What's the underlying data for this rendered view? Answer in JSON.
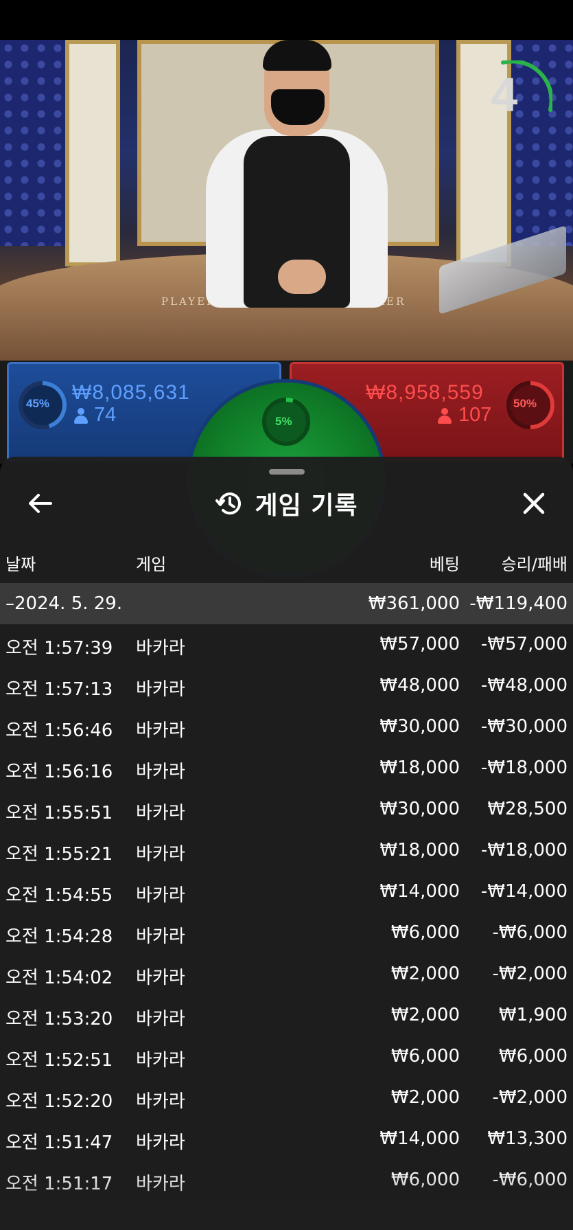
{
  "video": {
    "countdown": "4",
    "table_labels": {
      "player": "PLAYER",
      "banker": "BANKER"
    }
  },
  "bets": {
    "player": {
      "percent": "45%",
      "percent_value": 45,
      "amount": "₩8,085,631",
      "count": "74",
      "color": "#3d7fd6"
    },
    "tie": {
      "percent": "5%",
      "percent_value": 5,
      "color": "#23c14a"
    },
    "banker": {
      "percent": "50%",
      "percent_value": 50,
      "amount": "₩8,958,559",
      "count": "107",
      "color": "#e03a3a"
    }
  },
  "history": {
    "title": "게임 기록",
    "columns": {
      "date": "날짜",
      "game": "게임",
      "bet": "베팅",
      "result": "승리/패배"
    },
    "day": {
      "date": "–2024. 5. 29.",
      "bet_total": "₩361,000",
      "result_total": "-₩119,400"
    },
    "rows": [
      {
        "time": "오전 1:57:39",
        "game": "바카라",
        "bet": "₩57,000",
        "result": "-₩57,000"
      },
      {
        "time": "오전 1:57:13",
        "game": "바카라",
        "bet": "₩48,000",
        "result": "-₩48,000"
      },
      {
        "time": "오전 1:56:46",
        "game": "바카라",
        "bet": "₩30,000",
        "result": "-₩30,000"
      },
      {
        "time": "오전 1:56:16",
        "game": "바카라",
        "bet": "₩18,000",
        "result": "-₩18,000"
      },
      {
        "time": "오전 1:55:51",
        "game": "바카라",
        "bet": "₩30,000",
        "result": "₩28,500"
      },
      {
        "time": "오전 1:55:21",
        "game": "바카라",
        "bet": "₩18,000",
        "result": "-₩18,000"
      },
      {
        "time": "오전 1:54:55",
        "game": "바카라",
        "bet": "₩14,000",
        "result": "-₩14,000"
      },
      {
        "time": "오전 1:54:28",
        "game": "바카라",
        "bet": "₩6,000",
        "result": "-₩6,000"
      },
      {
        "time": "오전 1:54:02",
        "game": "바카라",
        "bet": "₩2,000",
        "result": "-₩2,000"
      },
      {
        "time": "오전 1:53:20",
        "game": "바카라",
        "bet": "₩2,000",
        "result": "₩1,900"
      },
      {
        "time": "오전 1:52:51",
        "game": "바카라",
        "bet": "₩6,000",
        "result": "₩6,000"
      },
      {
        "time": "오전 1:52:20",
        "game": "바카라",
        "bet": "₩2,000",
        "result": "-₩2,000"
      },
      {
        "time": "오전 1:51:47",
        "game": "바카라",
        "bet": "₩14,000",
        "result": "₩13,300"
      },
      {
        "time": "오전 1:51:17",
        "game": "바카라",
        "bet": "₩6,000",
        "result": "-₩6,000"
      }
    ]
  },
  "icons": {
    "back": "arrow-left-icon",
    "history": "history-icon",
    "close": "close-icon"
  }
}
